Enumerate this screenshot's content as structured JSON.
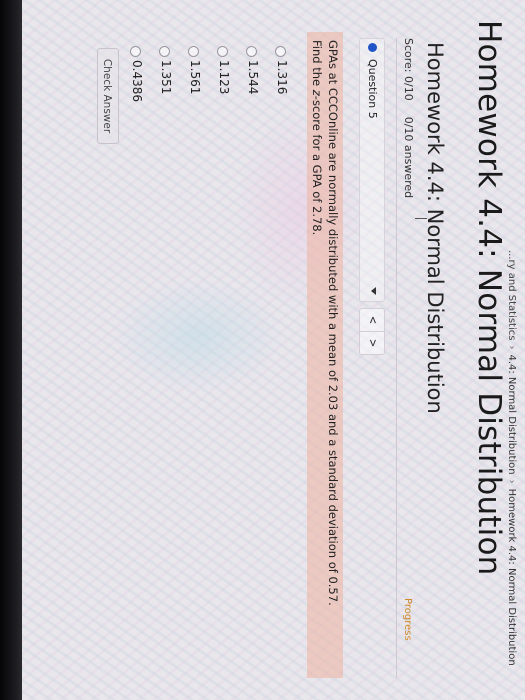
{
  "breadcrumb": {
    "items": [
      "...ry and Statistics",
      "4.4: Normal Distribution",
      "Homework 4.4: Normal Distribution"
    ],
    "separator": "›"
  },
  "page_title": "Homework 4.4: Normal Distribution",
  "assignment": {
    "title": "Homework 4.4: Normal Distribution",
    "score": "Score: 0/10",
    "answered": "0/10 answered",
    "progress_label": "Progress"
  },
  "question_nav": {
    "label": "Question 5",
    "prev": "<",
    "next": ">"
  },
  "question": {
    "line1": "GPAs at CCCOnline are normally distributed with a mean of 2.03 and a standard deviation of 0.57.",
    "line2_prefix": "Find the ",
    "line2_var": "z",
    "line2_suffix": "-score for a GPA of 2.78."
  },
  "options": [
    "1.316",
    "1.544",
    "1.123",
    "1.561",
    "1.351",
    "0.4386"
  ],
  "check_answer_label": "Check Answer",
  "colors": {
    "question_highlight": "#eeb2a0",
    "accent_blue": "#1f55c7",
    "progress_orange": "#d08a2a"
  }
}
